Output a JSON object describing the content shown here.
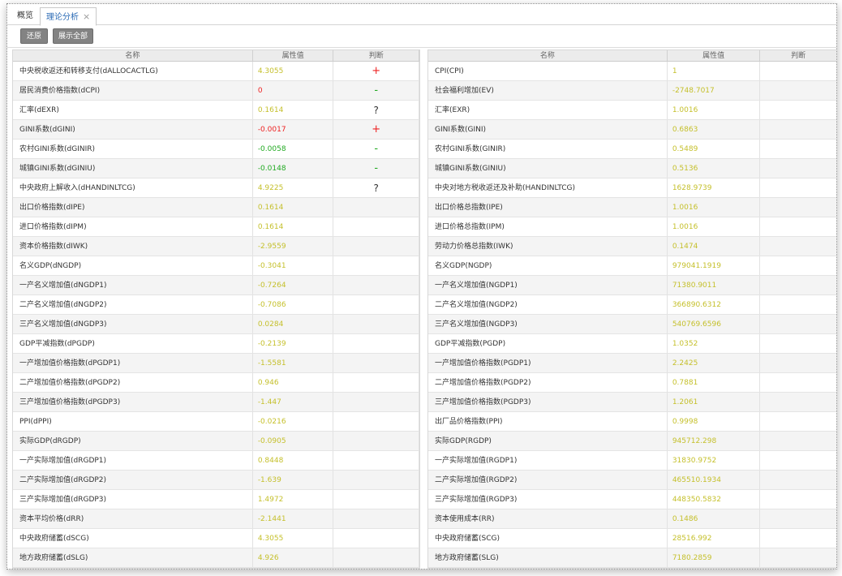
{
  "tabs": [
    {
      "label": "概览"
    },
    {
      "label": "理论分析",
      "close": "×"
    }
  ],
  "toolbar": {
    "restore_label": "还原",
    "expand_label": "展示全部"
  },
  "left_table": {
    "headers": {
      "name": "名称",
      "value": "属性值",
      "judge": "判断"
    },
    "rows": [
      {
        "name": "中央税收返还和转移支付(dALLOCACTLG)",
        "value": "4.3055",
        "judge": "+",
        "color": "yellow"
      },
      {
        "name": "居民消费价格指数(dCPI)",
        "value": "0",
        "judge": "-",
        "color": "red"
      },
      {
        "name": "汇率(dEXR)",
        "value": "0.1614",
        "judge": "?",
        "color": "yellow"
      },
      {
        "name": "GINI系数(dGINI)",
        "value": "-0.0017",
        "judge": "+",
        "color": "red"
      },
      {
        "name": "农村GINI系数(dGINIR)",
        "value": "-0.0058",
        "judge": "-",
        "color": "green"
      },
      {
        "name": "城镇GINI系数(dGINIU)",
        "value": "-0.0148",
        "judge": "-",
        "color": "green"
      },
      {
        "name": "中央政府上解收入(dHANDINLTCG)",
        "value": "4.9225",
        "judge": "?",
        "color": "yellow"
      },
      {
        "name": "出口价格指数(dIPE)",
        "value": "0.1614",
        "judge": "",
        "color": "yellow"
      },
      {
        "name": "进口价格指数(dIPM)",
        "value": "0.1614",
        "judge": "",
        "color": "yellow"
      },
      {
        "name": "资本价格指数(dIWK)",
        "value": "-2.9559",
        "judge": "",
        "color": "yellow"
      },
      {
        "name": "名义GDP(dNGDP)",
        "value": "-0.3041",
        "judge": "",
        "color": "yellow"
      },
      {
        "name": "一产名义增加值(dNGDP1)",
        "value": "-0.7264",
        "judge": "",
        "color": "yellow"
      },
      {
        "name": "二产名义增加值(dNGDP2)",
        "value": "-0.7086",
        "judge": "",
        "color": "yellow"
      },
      {
        "name": "三产名义增加值(dNGDP3)",
        "value": "0.0284",
        "judge": "",
        "color": "yellow"
      },
      {
        "name": "GDP平减指数(dPGDP)",
        "value": "-0.2139",
        "judge": "",
        "color": "yellow"
      },
      {
        "name": "一产增加值价格指数(dPGDP1)",
        "value": "-1.5581",
        "judge": "",
        "color": "yellow"
      },
      {
        "name": "二产增加值价格指数(dPGDP2)",
        "value": "0.946",
        "judge": "",
        "color": "yellow"
      },
      {
        "name": "三产增加值价格指数(dPGDP3)",
        "value": "-1.447",
        "judge": "",
        "color": "yellow"
      },
      {
        "name": "PPI(dPPI)",
        "value": "-0.0216",
        "judge": "",
        "color": "yellow"
      },
      {
        "name": "实际GDP(dRGDP)",
        "value": "-0.0905",
        "judge": "",
        "color": "yellow"
      },
      {
        "name": "一产实际增加值(dRGDP1)",
        "value": "0.8448",
        "judge": "",
        "color": "yellow"
      },
      {
        "name": "二产实际增加值(dRGDP2)",
        "value": "-1.639",
        "judge": "",
        "color": "yellow"
      },
      {
        "name": "三产实际增加值(dRGDP3)",
        "value": "1.4972",
        "judge": "",
        "color": "yellow"
      },
      {
        "name": "资本平均价格(dRR)",
        "value": "-2.1441",
        "judge": "",
        "color": "yellow"
      },
      {
        "name": "中央政府储蓄(dSCG)",
        "value": "4.3055",
        "judge": "",
        "color": "yellow"
      },
      {
        "name": "地方政府储蓄(dSLG)",
        "value": "4.926",
        "judge": "",
        "color": "yellow"
      }
    ]
  },
  "right_table": {
    "headers": {
      "name": "名称",
      "value": "属性值",
      "judge": "判断"
    },
    "rows": [
      {
        "name": "CPI(CPI)",
        "value": "1",
        "judge": "",
        "color": "yellow"
      },
      {
        "name": "社会福利增加(EV)",
        "value": "-2748.7017",
        "judge": "",
        "color": "yellow"
      },
      {
        "name": "汇率(EXR)",
        "value": "1.0016",
        "judge": "",
        "color": "yellow"
      },
      {
        "name": "GINI系数(GINI)",
        "value": "0.6863",
        "judge": "",
        "color": "yellow"
      },
      {
        "name": "农村GINI系数(GINIR)",
        "value": "0.5489",
        "judge": "",
        "color": "yellow"
      },
      {
        "name": "城镇GINI系数(GINIU)",
        "value": "0.5136",
        "judge": "",
        "color": "yellow"
      },
      {
        "name": "中央对地方税收返还及补助(HANDINLTCG)",
        "value": "1628.9739",
        "judge": "",
        "color": "yellow"
      },
      {
        "name": "出口价格总指数(IPE)",
        "value": "1.0016",
        "judge": "",
        "color": "yellow"
      },
      {
        "name": "进口价格总指数(IPM)",
        "value": "1.0016",
        "judge": "",
        "color": "yellow"
      },
      {
        "name": "劳动力价格总指数(IWK)",
        "value": "0.1474",
        "judge": "",
        "color": "yellow"
      },
      {
        "name": "名义GDP(NGDP)",
        "value": "979041.1919",
        "judge": "",
        "color": "yellow"
      },
      {
        "name": "一产名义增加值(NGDP1)",
        "value": "71380.9011",
        "judge": "",
        "color": "yellow"
      },
      {
        "name": "二产名义增加值(NGDP2)",
        "value": "366890.6312",
        "judge": "",
        "color": "yellow"
      },
      {
        "name": "三产名义增加值(NGDP3)",
        "value": "540769.6596",
        "judge": "",
        "color": "yellow"
      },
      {
        "name": "GDP平减指数(PGDP)",
        "value": "1.0352",
        "judge": "",
        "color": "yellow"
      },
      {
        "name": "一产增加值价格指数(PGDP1)",
        "value": "2.2425",
        "judge": "",
        "color": "yellow"
      },
      {
        "name": "二产增加值价格指数(PGDP2)",
        "value": "0.7881",
        "judge": "",
        "color": "yellow"
      },
      {
        "name": "三产增加值价格指数(PGDP3)",
        "value": "1.2061",
        "judge": "",
        "color": "yellow"
      },
      {
        "name": "出厂品价格指数(PPI)",
        "value": "0.9998",
        "judge": "",
        "color": "yellow"
      },
      {
        "name": "实际GDP(RGDP)",
        "value": "945712.298",
        "judge": "",
        "color": "yellow"
      },
      {
        "name": "一产实际增加值(RGDP1)",
        "value": "31830.9752",
        "judge": "",
        "color": "yellow"
      },
      {
        "name": "二产实际增加值(RGDP2)",
        "value": "465510.1934",
        "judge": "",
        "color": "yellow"
      },
      {
        "name": "三产实际增加值(RGDP3)",
        "value": "448350.5832",
        "judge": "",
        "color": "yellow"
      },
      {
        "name": "资本使用成本(RR)",
        "value": "0.1486",
        "judge": "",
        "color": "yellow"
      },
      {
        "name": "中央政府储蓄(SCG)",
        "value": "28516.992",
        "judge": "",
        "color": "yellow"
      },
      {
        "name": "地方政府储蓄(SLG)",
        "value": "7180.2859",
        "judge": "",
        "color": "yellow"
      }
    ]
  }
}
